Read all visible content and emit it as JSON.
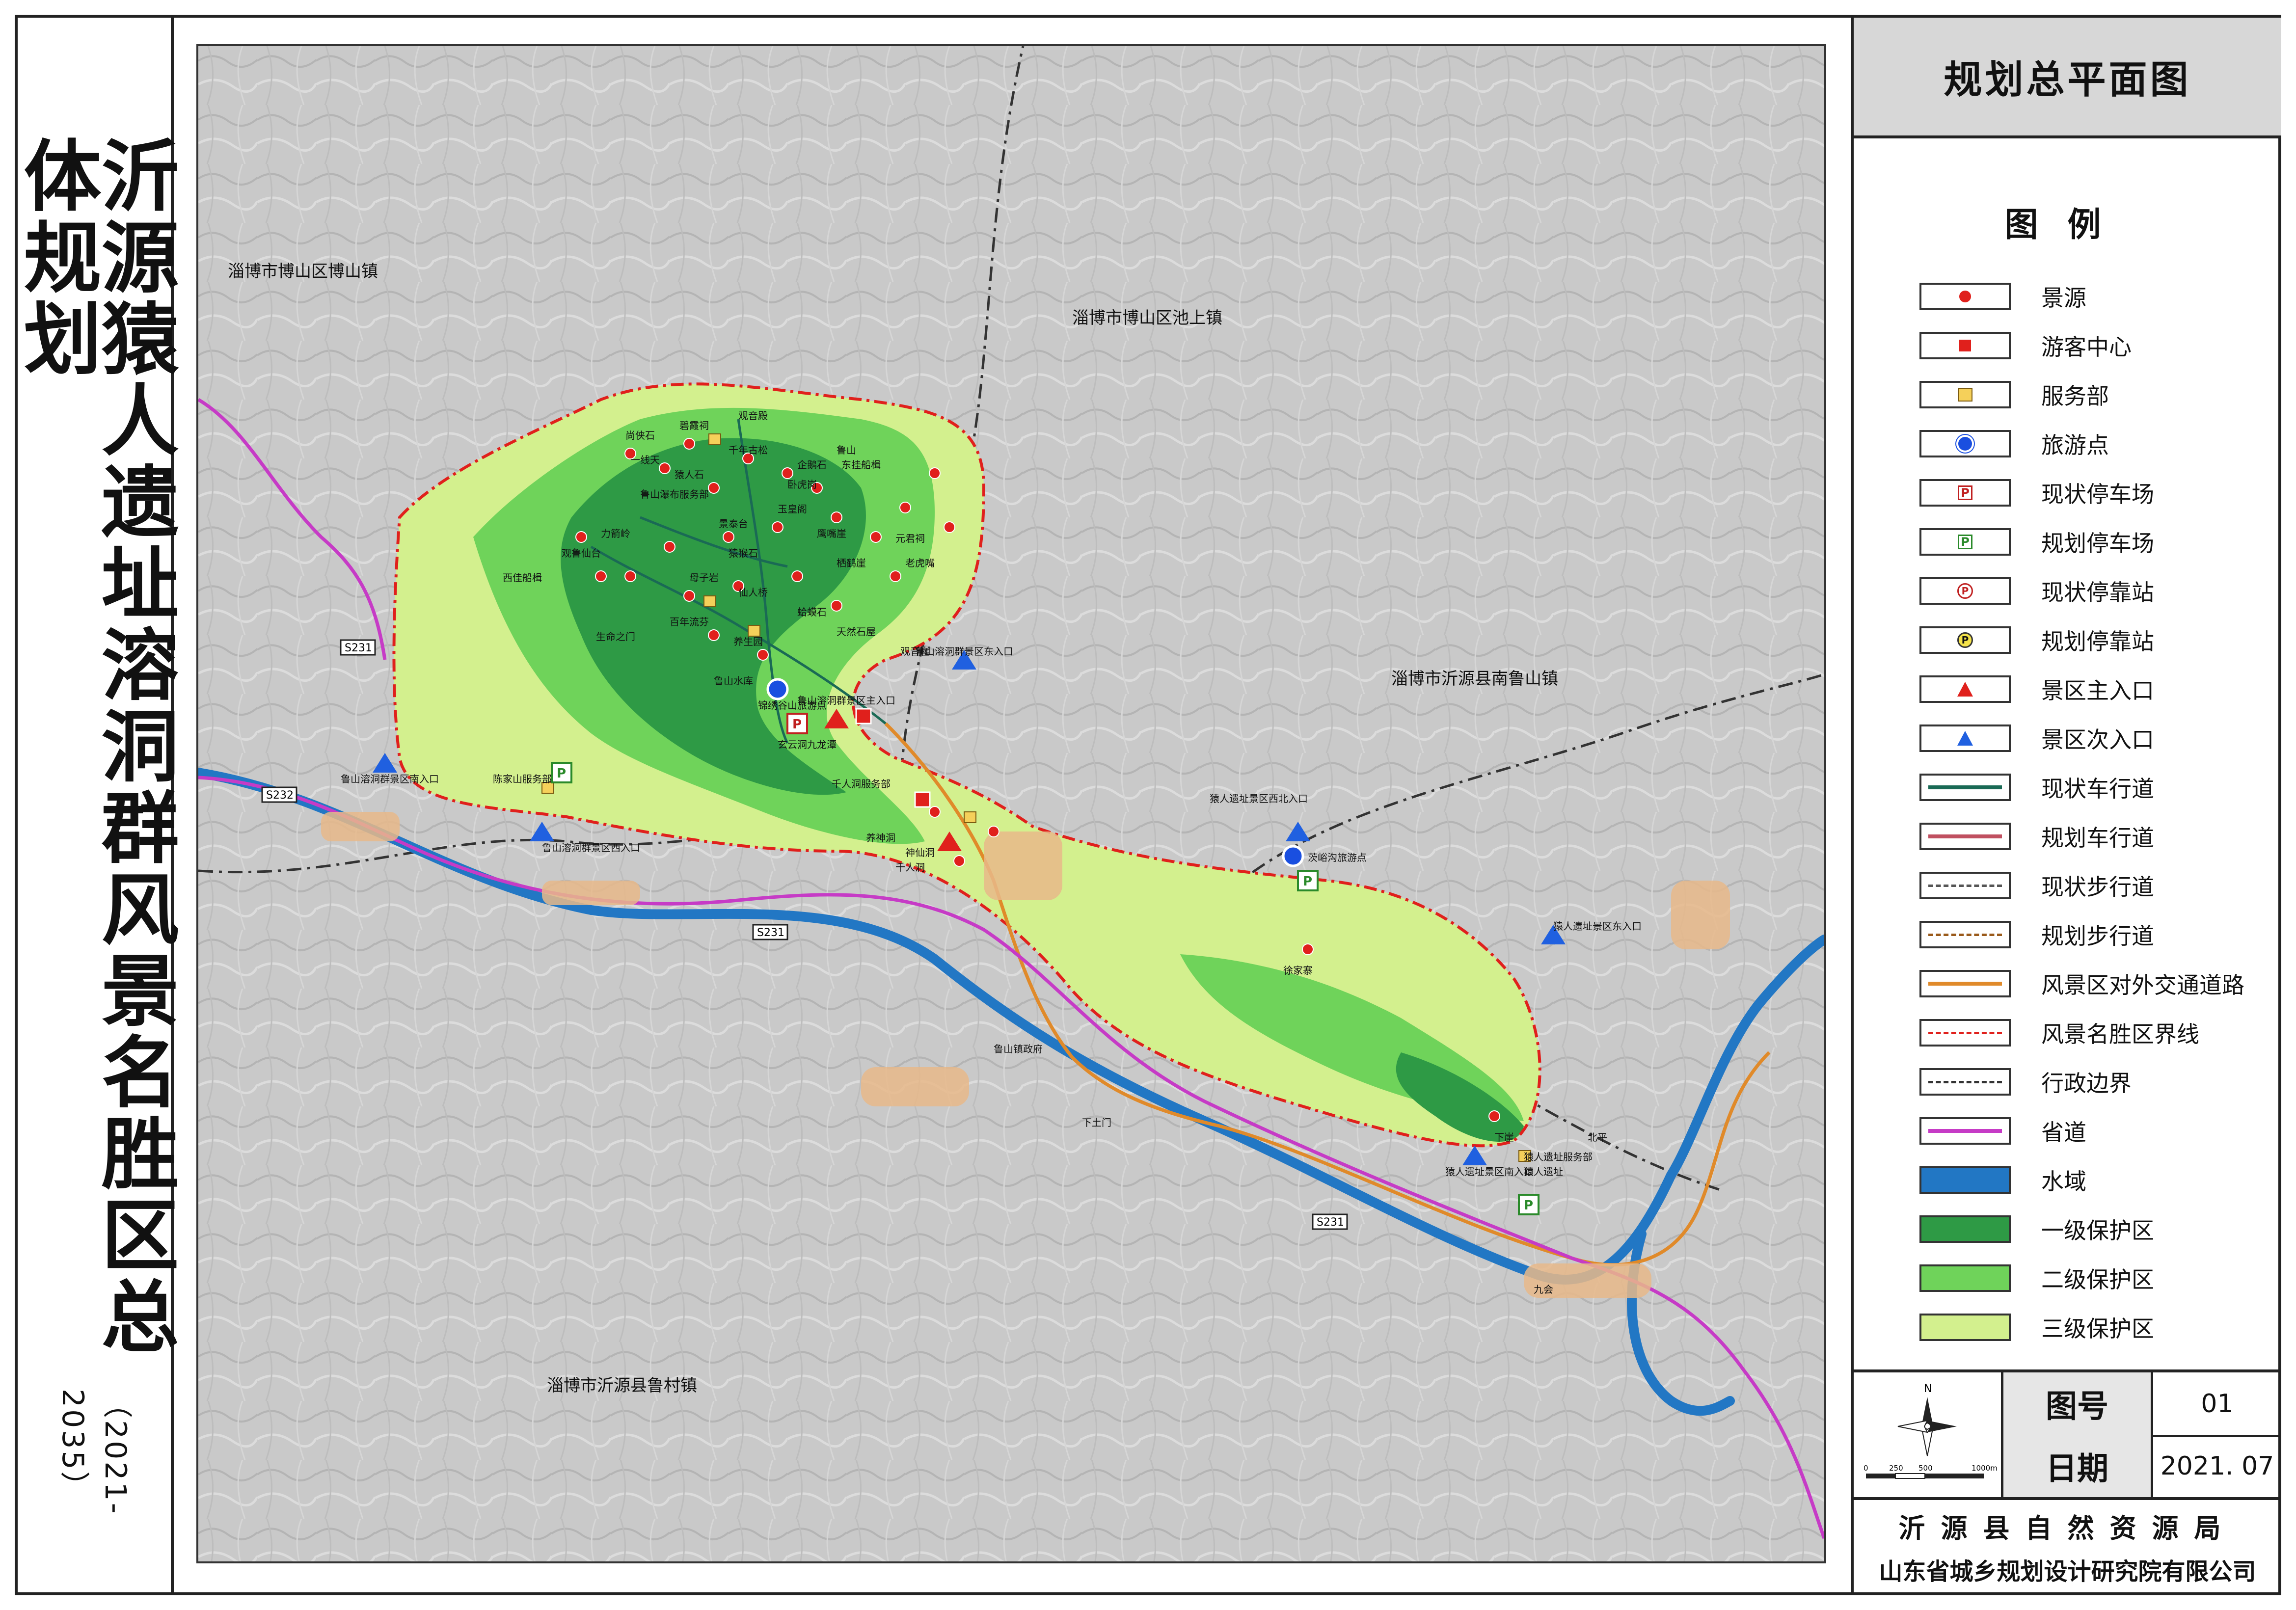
{
  "title": {
    "main": "沂源猿人遗址溶洞群风景名胜区总体规划",
    "years": "（2021-2035）"
  },
  "panel": {
    "title": "规划总平面图",
    "legend_title": "图例",
    "legend": [
      {
        "label": "景源",
        "icon": "red-dot-icon"
      },
      {
        "label": "游客中心",
        "icon": "red-square-icon"
      },
      {
        "label": "服务部",
        "icon": "yellow-square-icon"
      },
      {
        "label": "旅游点",
        "icon": "blue-circle-icon"
      },
      {
        "label": "现状停车场",
        "icon": "parking-red-icon"
      },
      {
        "label": "规划停车场",
        "icon": "parking-green-icon"
      },
      {
        "label": "现状停靠站",
        "icon": "stop-red-icon"
      },
      {
        "label": "规划停靠站",
        "icon": "stop-yellow-icon"
      },
      {
        "label": "景区主入口",
        "icon": "red-triangle-icon"
      },
      {
        "label": "景区次入口",
        "icon": "blue-triangle-icon"
      },
      {
        "label": "现状车行道",
        "icon": "road-existing-icon"
      },
      {
        "label": "规划车行道",
        "icon": "road-planned-icon"
      },
      {
        "label": "现状步行道",
        "icon": "footpath-existing-icon"
      },
      {
        "label": "规划步行道",
        "icon": "footpath-planned-icon"
      },
      {
        "label": "风景区对外交通道路",
        "icon": "access-road-icon"
      },
      {
        "label": "风景名胜区界线",
        "icon": "scenic-boundary-icon"
      },
      {
        "label": "行政边界",
        "icon": "admin-boundary-icon"
      },
      {
        "label": "省道",
        "icon": "provincial-road-icon"
      },
      {
        "label": "水域",
        "icon": "water-icon"
      },
      {
        "label": "一级保护区",
        "icon": "protection-1-icon"
      },
      {
        "label": "二级保护区",
        "icon": "protection-2-icon"
      },
      {
        "label": "三级保护区",
        "icon": "protection-3-icon"
      }
    ],
    "colors": {
      "protection_1": "#2e9a45",
      "protection_2": "#6fd35a",
      "protection_3": "#d3f08e",
      "scenic_boundary": "#e0201c",
      "provincial_road": "#c63bc6",
      "water": "#2277c4",
      "access_road": "#e08a2a",
      "existing_road": "#1a6a55"
    },
    "north_label": "N",
    "scale_labels": [
      "0",
      "250",
      "500",
      "1000m"
    ],
    "figure_number_label": "图号",
    "figure_number": "01",
    "date_label": "日期",
    "date": "2021. 07",
    "org1": "沂源县自然资源局",
    "org2": "山东省城乡规划设计研究院有限公司"
  },
  "map": {
    "regions": [
      "淄博市博山区博山镇",
      "淄博市博山区池上镇",
      "淄博市沂源县南鲁山镇",
      "淄博市沂源县鲁村镇"
    ],
    "roads": [
      "S231",
      "S232",
      "S231",
      "S231"
    ],
    "entrances": [
      "鲁山溶洞群景区南入口",
      "鲁山溶洞群景区东入口",
      "鲁山溶洞群景区主入口",
      "猿人遗址景区西北入口",
      "猿人遗址景区东入口",
      "猿人遗址景区南入口",
      "鲁山溶洞群景区西入口"
    ],
    "places": [
      "尚侠石",
      "碧霞祠",
      "观音殿",
      "一线天",
      "猿人石",
      "千年古松",
      "企鹅石",
      "东挂船楫",
      "鲁山瀑布服务部",
      "卧虎岗",
      "鲁山",
      "玉皇阁",
      "景泰台",
      "鹰嘴崖",
      "栖鹤崖",
      "力箭岭",
      "观鲁仙台",
      "猿猴石",
      "元君祠",
      "老虎嘴",
      "母子岩",
      "仙人桥",
      "蛤蟆石",
      "天然石屋",
      "鲁山水库",
      "锦绣谷山旅游点",
      "九龙潭",
      "玄云洞",
      "千人洞服务部",
      "养神洞",
      "千人洞",
      "神仙洞",
      "茨峪沟旅游点",
      "徐家寨",
      "鲁山镇政府",
      "下土门",
      "下崖",
      "猿人遗址",
      "猿人遗址服务部",
      "北平",
      "九会",
      "陈家山服务部",
      "西佳船楫",
      "观音崖",
      "生命之门",
      "百年流芬",
      "养生园"
    ]
  }
}
